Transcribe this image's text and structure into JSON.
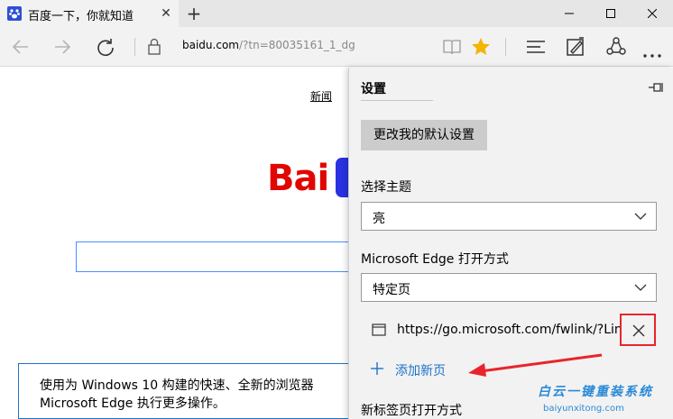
{
  "tab": {
    "title": "百度一下，你就知道",
    "close_glyph": "✕"
  },
  "new_tab": {
    "glyph": "+"
  },
  "address": {
    "host": "baidu.com",
    "path": "/?tn=80035161_1_dg"
  },
  "page": {
    "news_link": "新闻",
    "logo_text": "Bai",
    "promo_line1": "使用为 Windows 10 构建的快速、全新的浏览器",
    "promo_line2": "Microsoft Edge 执行更多操作。"
  },
  "settings": {
    "title": "设置",
    "default_button": "更改我的默认设置",
    "theme_label": "选择主题",
    "theme_value": "亮",
    "open_label": "Microsoft Edge 打开方式",
    "open_value": "特定页",
    "url_value": "https://go.microsoft.com/fwlink/?Lin",
    "add_page": "添加新页",
    "newtab_label": "新标签页打开方式"
  },
  "watermark": {
    "line1": "白云一键重装系统",
    "line2": "baiyunxitong.com"
  },
  "colors": {
    "accent_blue": "#1e73c8",
    "highlight_red": "#e8252a",
    "star_gold": "#f4b400",
    "baidu_red": "#e10602",
    "baidu_blue": "#2932e1"
  }
}
